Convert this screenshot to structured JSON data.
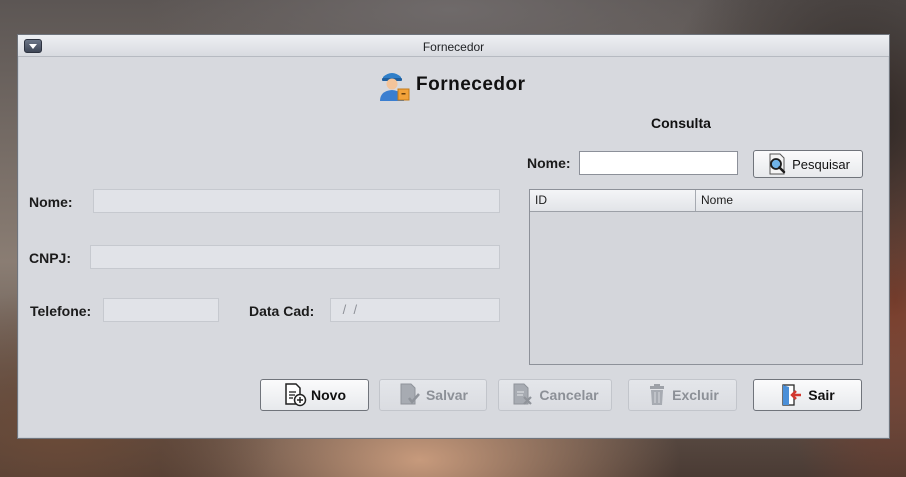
{
  "window": {
    "title": "Fornecedor"
  },
  "heading": {
    "title": "Fornecedor",
    "icon": "supplier-person-icon"
  },
  "form": {
    "nome_label": "Nome:",
    "nome_value": "",
    "cnpj_label": "CNPJ:",
    "cnpj_value": "",
    "telefone_label": "Telefone:",
    "telefone_value": "",
    "datacad_label": "Data Cad:",
    "datacad_value": " /  /"
  },
  "consulta": {
    "title": "Consulta",
    "nome_label": "Nome:",
    "nome_value": "",
    "search_button": "Pesquisar",
    "columns": [
      "ID",
      "Nome"
    ],
    "rows": []
  },
  "actions": {
    "novo": "Novo",
    "salvar": "Salvar",
    "cancelar": "Cancelar",
    "excluir": "Excluir",
    "sair": "Sair"
  }
}
